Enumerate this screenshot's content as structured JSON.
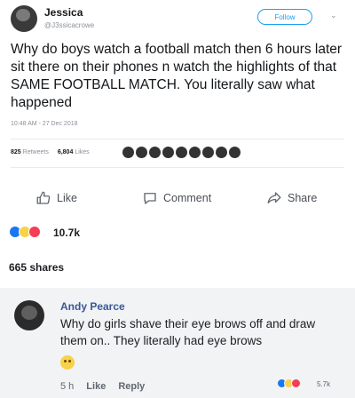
{
  "tweet": {
    "name": "Jessica",
    "handle": "@J3ssicacrowe",
    "follow_label": "Follow",
    "text": "Why do boys watch a football match then 6 hours later sit there on their phones n watch the highlights of that SAME FOOTBALL MATCH. You literally saw what happened",
    "timestamp": "10:48 AM - 27 Dec 2018",
    "retweets_count": "825",
    "retweets_label": "Retweets",
    "likes_count": "6,804",
    "likes_label": "Likes"
  },
  "actions": {
    "like_label": "Like",
    "comment_label": "Comment",
    "share_label": "Share"
  },
  "reactions": {
    "icons": [
      "like-reaction-icon",
      "haha-reaction-icon",
      "love-reaction-icon"
    ],
    "colors": [
      "#1877f2",
      "#f7d24a",
      "#f33e58"
    ],
    "count": "10.7k"
  },
  "shares_text": "665 shares",
  "comment": {
    "author": "Andy Pearce",
    "text": "Why do girls shave their eye brows off and draw them on.. They literally had eye brows",
    "emoji": "thinking-face-icon",
    "age": "5 h",
    "like_label": "Like",
    "reply_label": "Reply",
    "reactions_count": "5.7k"
  }
}
